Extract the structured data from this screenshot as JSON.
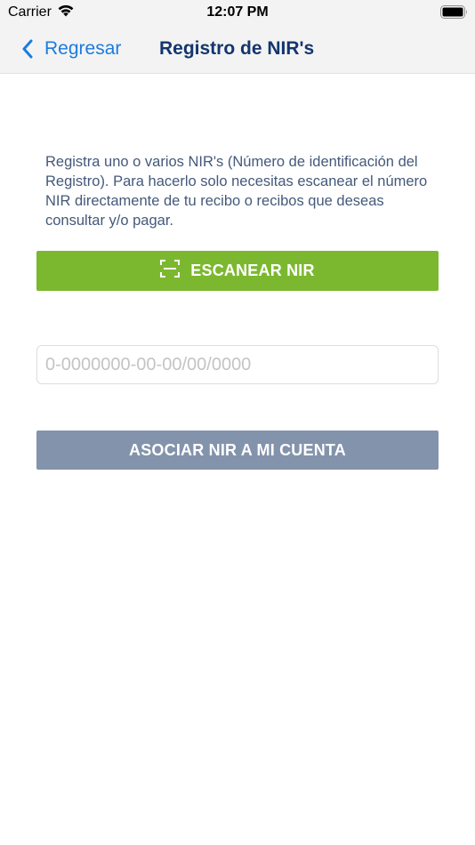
{
  "status_bar": {
    "carrier": "Carrier",
    "time": "12:07 PM",
    "wifi_icon": "wifi-icon",
    "battery_icon": "battery-icon"
  },
  "nav": {
    "back_label": "Regresar",
    "back_icon": "chevron-left-icon",
    "title": "Registro de NIR's"
  },
  "content": {
    "intro_text": "Registra uno o varios NIR's (Número de identificación del Registro). Para hacerlo solo necesitas escanear el número NIR directamente de tu recibo o recibos que deseas consultar y/o pagar.",
    "scan_button": {
      "label": "ESCANEAR NIR",
      "icon": "scan-frame-icon"
    },
    "nir_input": {
      "placeholder": "0-0000000-00-00/00/0000",
      "value": ""
    },
    "associate_button": {
      "label": "ASOCIAR NIR A MI CUENTA"
    }
  },
  "colors": {
    "accent_blue": "#1a7ce0",
    "title_navy": "#14356e",
    "body_text": "#44597a",
    "scan_green": "#7cb82f",
    "associate_gray_blue": "#8393ab",
    "topbar_bg": "#f3f3f3"
  }
}
